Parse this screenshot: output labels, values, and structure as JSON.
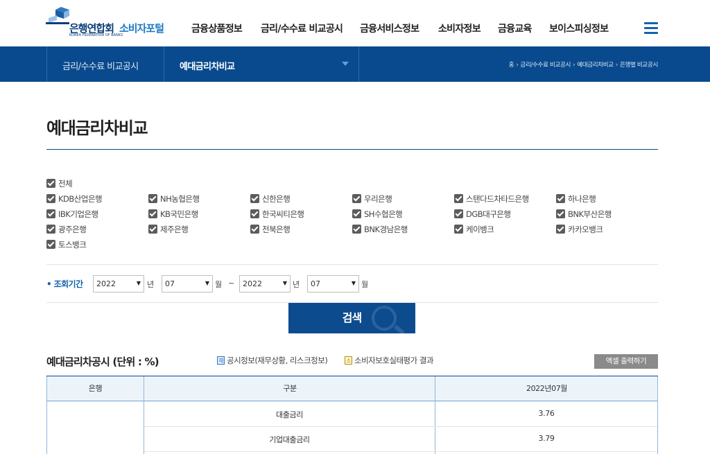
{
  "header": {
    "logo": {
      "name": "은행연합회",
      "sub": "KOREA FEDERATION OF BANKS",
      "portal": "소비자포털"
    },
    "nav": [
      "금융상품정보",
      "금리/수수료 비교공시",
      "금융서비스정보",
      "소비자정보",
      "금융교육",
      "보이스피싱정보"
    ],
    "menu_icon": "hamburger-icon"
  },
  "subbar": {
    "category": "금리/수수료 비교공시",
    "current": "예대금리차비교",
    "breadcrumb": [
      "홈",
      "금리/수수료 비교공시",
      "예대금리차비교",
      "은행별 비교공시"
    ]
  },
  "page_title": "예대금리차비교",
  "filters": {
    "all_label": "전체",
    "banks": [
      "KDB산업은행",
      "NH농협은행",
      "신한은행",
      "우리은행",
      "스탠다드차타드은행",
      "하나은행",
      "IBK기업은행",
      "KB국민은행",
      "한국씨티은행",
      "SH수협은행",
      "DGB대구은행",
      "BNK부산은행",
      "광주은행",
      "제주은행",
      "전북은행",
      "BNK경남은행",
      "케이뱅크",
      "카카오뱅크",
      "토스뱅크"
    ],
    "all_checked": true
  },
  "period": {
    "label": "• 조회기간",
    "start_year": "2022",
    "start_month": "07",
    "end_year": "2022",
    "end_month": "07",
    "year_unit": "년",
    "month_unit": "월",
    "tilde": "~"
  },
  "search_label": "검색",
  "section": {
    "title": "예대금리차공시 (단위 : %)",
    "legend": [
      {
        "tag": "재",
        "text": "공시정보(재무상황, 리스크정보)"
      },
      {
        "tag": "소",
        "text": "소비자보호실태평가 결과"
      }
    ],
    "excel_label": "엑셀 출력하기"
  },
  "table": {
    "headers": [
      "은행",
      "구분",
      "2022년07월"
    ],
    "rows": [
      {
        "type": "대출금리",
        "value": "3.76"
      },
      {
        "type": "기업대출금리",
        "value": "3.79"
      }
    ]
  },
  "colors": {
    "primary": "#084a8d",
    "accent": "#1262ae",
    "checkbox": "#5c5c5c"
  }
}
